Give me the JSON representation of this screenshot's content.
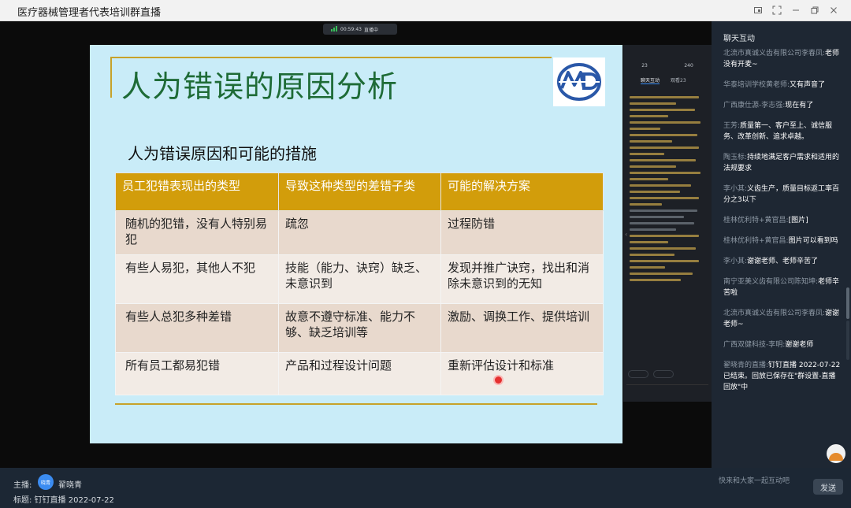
{
  "window": {
    "title": "医疗器械管理者代表培训群直播"
  },
  "stream": {
    "net_pill_time": "00:59:43",
    "net_pill_text": "直播中"
  },
  "slide": {
    "title": "人为错误的原因分析",
    "subtitle": "人为错误原因和可能的措施",
    "table": {
      "headers": [
        "员工犯错表现出的类型",
        "导致这种类型的差错子类",
        "可能的解决方案"
      ],
      "rows": [
        [
          "随机的犯错，没有人特别易犯",
          "疏忽",
          "过程防错"
        ],
        [
          "有些人易犯，其他人不犯",
          "技能（能力、诀窍）缺乏、未意识到",
          "发现并推广诀窍，找出和消除未意识到的无知"
        ],
        [
          "有些人总犯多种差错",
          "故意不遵守标准、能力不够、缺乏培训等",
          "激励、调换工作、提供培训"
        ],
        [
          "所有员工都易犯错",
          "产品和过程设计问题",
          "重新评估设计和标准"
        ]
      ]
    }
  },
  "mini_panel": {
    "stat1_value": "23",
    "stat2_value": "240",
    "tab_active": "聊天互动",
    "tab_other": "观看23"
  },
  "host": {
    "label": "主播:",
    "avatar_text": "晓青",
    "name": "翟晓青",
    "subject": "标题: 钉钉直播 2022-07-22"
  },
  "chat": {
    "header": "聊天互动",
    "messages": [
      {
        "who": "北流市真诚义齿有限公司李春凤:",
        "text": "老师没有开麦~"
      },
      {
        "who": "华泰培训学校黄老师:",
        "text": "又有声音了"
      },
      {
        "who": "广西康仕源-李志强:",
        "text": "现在有了"
      },
      {
        "who": "王芳:",
        "text": "质量第一、客户至上、诚信服务、改革创新、追求卓越。"
      },
      {
        "who": "陶玉标:",
        "text": "持续地满足客户需求和适用的法规要求"
      },
      {
        "who": "李小其:",
        "text": "义齿生产，质量目标返工率百分之3以下"
      },
      {
        "who": "桂林优利特+黄官昌:",
        "text": "[图片]"
      },
      {
        "who": "桂林优利特+黄官昌:",
        "text": "图片可以看到吗"
      },
      {
        "who": "李小其:",
        "text": "谢谢老师、老师辛苦了"
      },
      {
        "who": "南宁亚美义齿有限公司陈知坤:",
        "text": "老师辛苦啦"
      },
      {
        "who": "北流市真诚义齿有限公司李春凤:",
        "text": "谢谢老师~"
      },
      {
        "who": "广西双健科技-李明:",
        "text": "谢谢老师"
      },
      {
        "who": "翟晓青的直播:",
        "text": "钉钉直播 2022-07-22 已结束。回放已保存在\"群设置-直播回放\"中"
      }
    ],
    "input_placeholder": "快来和大家一起互动吧",
    "send_label": "发送"
  },
  "colors": {
    "slide_bg": "#c9ecf8",
    "title_green": "#1e6b36",
    "table_header": "#d29d0b",
    "accent_blue": "#3b8cf1",
    "pointer_red": "#e53030"
  }
}
